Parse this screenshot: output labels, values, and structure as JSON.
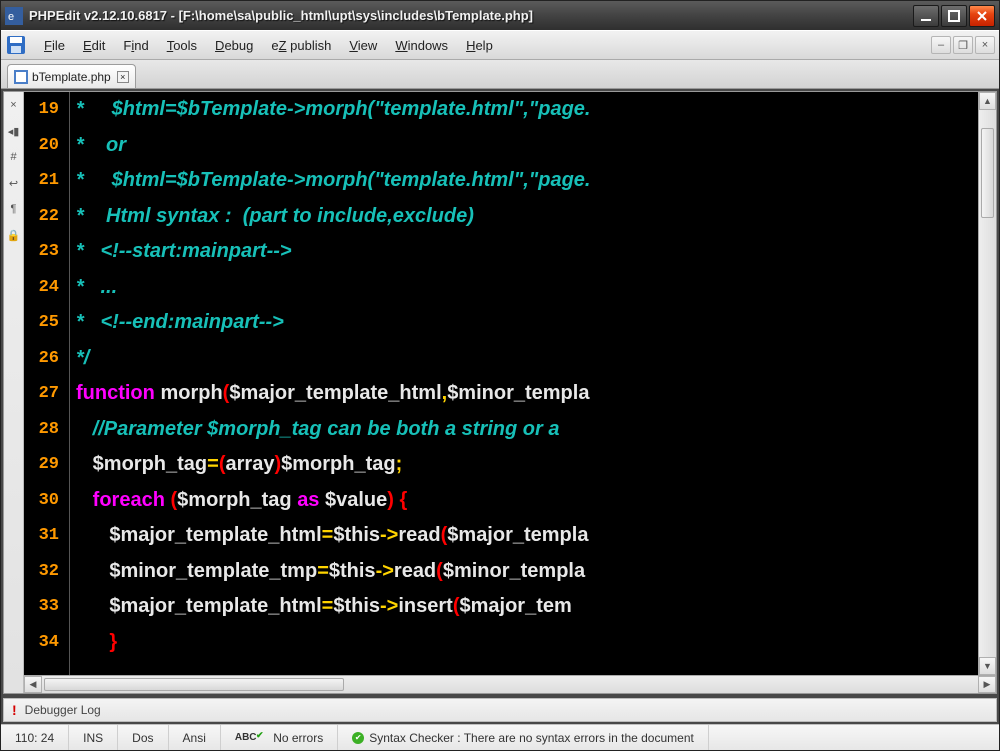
{
  "title": "PHPEdit v2.12.10.6817 - [F:\\home\\sa\\public_html\\upt\\sys\\includes\\bTemplate.php]",
  "menu": {
    "file": "File",
    "edit": "Edit",
    "find": "Find",
    "tools": "Tools",
    "debug": "Debug",
    "ez": "eZ publish",
    "view": "View",
    "windows": "Windows",
    "help": "Help"
  },
  "tab": {
    "label": "bTemplate.php"
  },
  "left_strip": [
    "×",
    "◂▮",
    "#",
    "↩",
    "¶",
    "🔒"
  ],
  "lines": {
    "start": 19,
    "items": [
      {
        "n": 19,
        "html": "<span class='comment'>*     $html=$bTemplate-&gt;morph(\"template.html\",\"page.</span>"
      },
      {
        "n": 20,
        "html": "<span class='comment'>*    or</span>"
      },
      {
        "n": 21,
        "html": "<span class='comment'>*     $html=$bTemplate-&gt;morph(\"template.html\",\"page.</span>"
      },
      {
        "n": 22,
        "html": "<span class='comment'>*    Html syntax :  (part to include,exclude)</span>"
      },
      {
        "n": 23,
        "html": "<span class='comment'>*   &lt;!--start:mainpart--&gt;</span>"
      },
      {
        "n": 24,
        "html": "<span class='comment'>*   ...</span>"
      },
      {
        "n": 25,
        "html": "<span class='comment'>*   &lt;!--end:mainpart--&gt;</span>"
      },
      {
        "n": 26,
        "html": "<span class='comment'>*/</span>"
      },
      {
        "n": 27,
        "html": "<span class='kw'>function</span> <span class='fn'>morph</span><span class='paren'>(</span><span class='var'>$major_template_html</span><span class='op'>,</span><span class='var'>$minor_templa</span>"
      },
      {
        "n": 28,
        "html": "   <span class='linecomment'>//Parameter $morph_tag can be both a string or a</span>"
      },
      {
        "n": 29,
        "html": "   <span class='nrm'><span class='var'>$morph_tag</span><span class='op'>=</span><span class='paren'>(</span><span class='cast'>array</span><span class='paren'>)</span><span class='var'>$morph_tag</span><span class='op'>;</span></span>"
      },
      {
        "n": 30,
        "html": "   <span class='kw'>foreach</span> <span class='paren'>(</span><span class='var'>$morph_tag</span> <span class='kw'>as</span> <span class='var'>$value</span><span class='paren'>)</span> <span class='paren'>{</span>"
      },
      {
        "n": 31,
        "html": "      <span class='nrm'><span class='var'>$major_template_html</span><span class='op'>=</span><span class='var'>$this</span><span class='op'>-&gt;</span><span class='fn'>read</span><span class='paren'>(</span><span class='var'>$major_templa</span></span>"
      },
      {
        "n": 32,
        "html": "      <span class='nrm'><span class='var'>$minor_template_tmp</span><span class='op'>=</span><span class='var'>$this</span><span class='op'>-&gt;</span><span class='fn'>read</span><span class='paren'>(</span><span class='var'>$minor_templa</span></span>"
      },
      {
        "n": 33,
        "html": "      <span class='nrm'><span class='var'>$major_template_html</span><span class='op'>=</span><span class='var'>$this</span><span class='op'>-&gt;</span><span class='fn'>insert</span><span class='paren'>(</span><span class='var'>$major_tem</span></span>"
      },
      {
        "n": 34,
        "html": "      <span class='paren'>}</span>"
      }
    ]
  },
  "debugger": {
    "label": "Debugger Log"
  },
  "status": {
    "pos": "110: 24",
    "ins": "INS",
    "dos": "Dos",
    "ansi": "Ansi",
    "noerr": "No errors",
    "syntax": "Syntax Checker : There are no syntax errors in the document"
  }
}
